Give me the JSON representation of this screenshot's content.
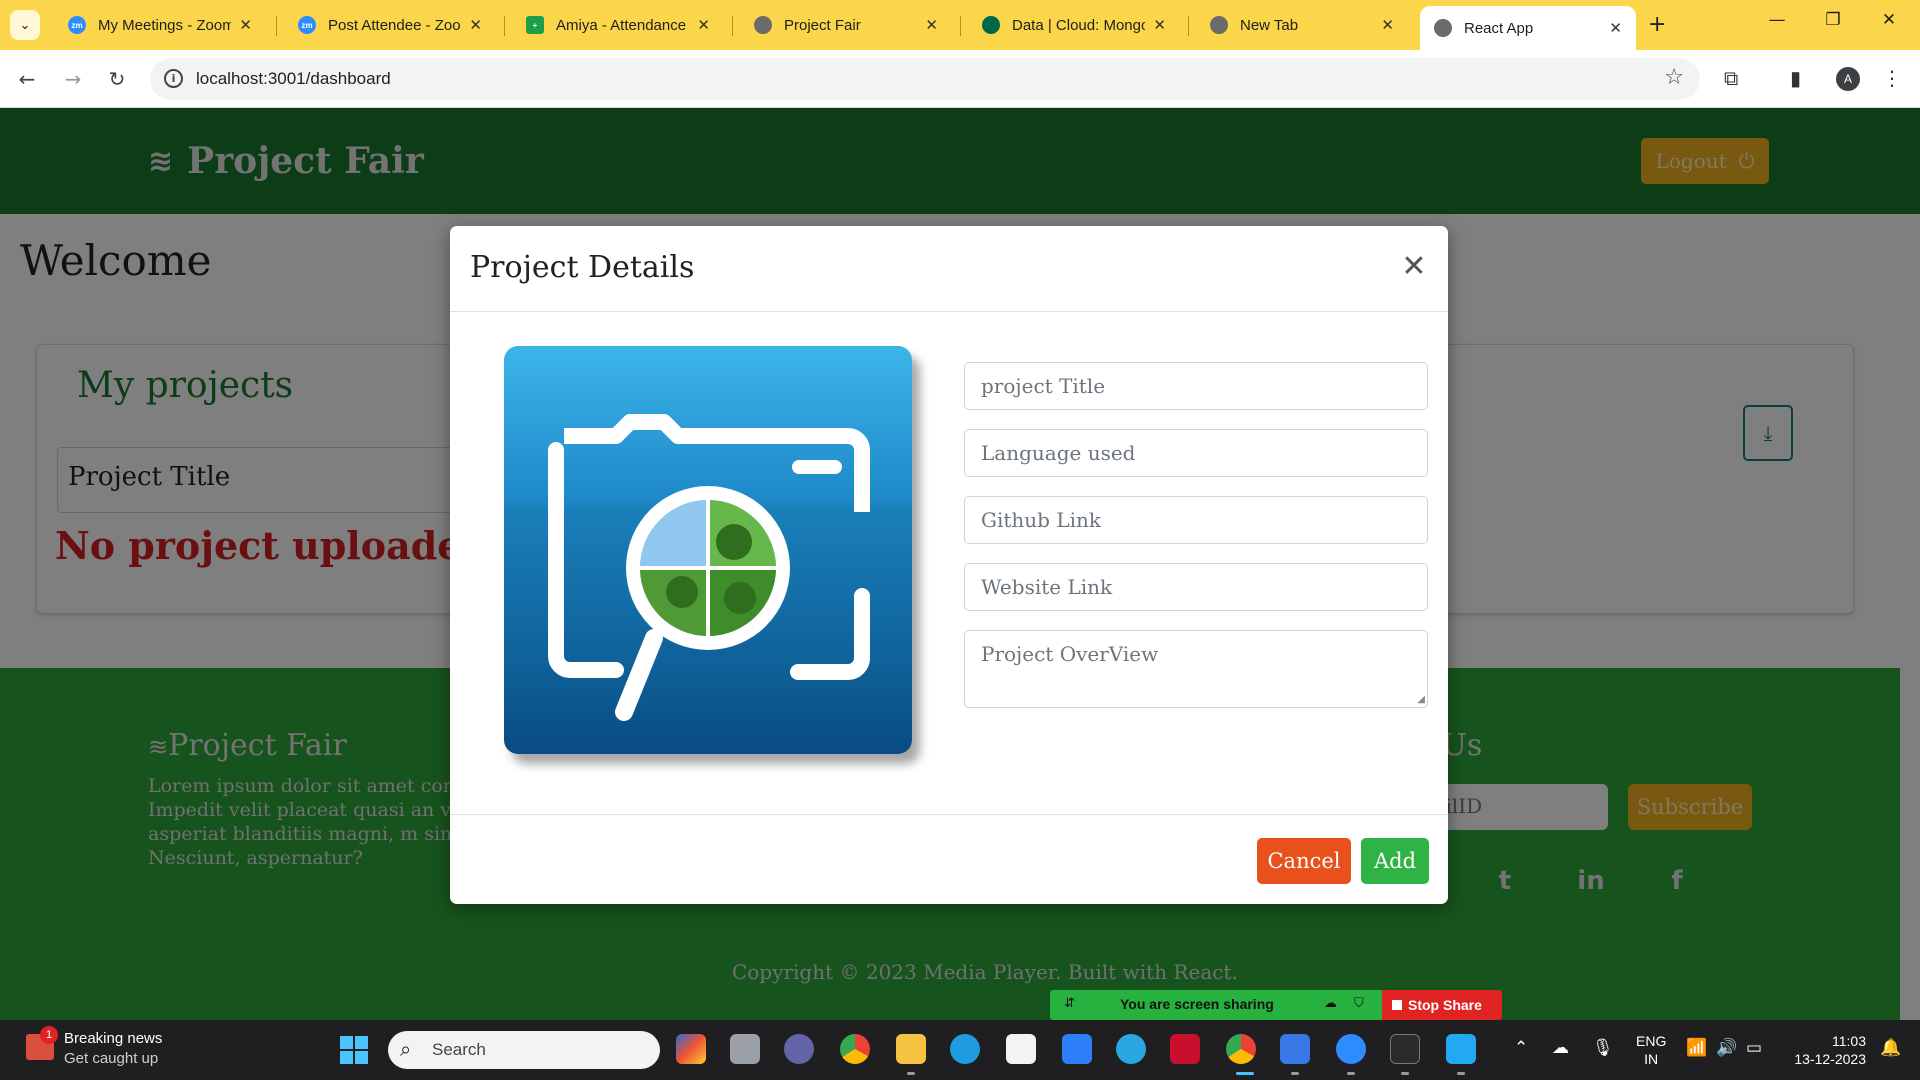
{
  "browser": {
    "tabs": [
      {
        "title": "My Meetings - Zoom",
        "favicon": "zoom-icon",
        "color": "#2d8cff"
      },
      {
        "title": "Post Attendee - Zoom",
        "favicon": "zoom-icon",
        "color": "#2d8cff"
      },
      {
        "title": "Amiya - Attendance",
        "favicon": "sheets-icon",
        "color": "#1e9e4a"
      },
      {
        "title": "Project Fair",
        "favicon": "globe-icon",
        "color": "#555555"
      },
      {
        "title": "Data | Cloud: MongoDB",
        "favicon": "mongodb-icon",
        "color": "#00684a"
      },
      {
        "title": "New Tab",
        "favicon": "chrome-icon",
        "color": "#555555"
      },
      {
        "title": "React App",
        "favicon": "globe-icon",
        "color": "#555555"
      }
    ],
    "url": "localhost:3001/dashboard",
    "profile_initial": "A"
  },
  "app": {
    "brand": "Project Fair",
    "logout_label": "Logout",
    "welcome": "Welcome",
    "my_projects_heading": "My projects",
    "project_title_label": "Project Title",
    "empty_message": "No project uploaded yet !!"
  },
  "footer": {
    "brand": "Project Fair",
    "text": "Lorem ipsum dolor sit amet conse elit. Impedit velit placeat quasi an vero asperiat blanditiis magni, m similique? Nesciunt, aspernatur?",
    "contact_heading": "t Us",
    "email_placeholder": "r EmailID",
    "subscribe_label": "Subscribe",
    "copyright": "Copyright © 2023 Media Player. Built with React."
  },
  "modal": {
    "title": "Project Details",
    "fields": {
      "title_placeholder": "project Title",
      "language_placeholder": "Language used",
      "github_placeholder": "Github Link",
      "website_placeholder": "Website Link",
      "overview_placeholder": "Project OverView"
    },
    "cancel_label": "Cancel",
    "add_label": "Add"
  },
  "screen_share": {
    "status": "You are screen sharing",
    "stop_label": "Stop Share"
  },
  "taskbar": {
    "news_title": "Breaking news",
    "news_subtitle": "Get caught up",
    "news_badge": "1",
    "search_label": "Search",
    "lang_line1": "ENG",
    "lang_line2": "IN",
    "time": "11:03",
    "date": "13-12-2023"
  },
  "colors": {
    "navbar": "#1b7a2e",
    "footer": "#2ea83a",
    "accent_yellow": "#f2b01e",
    "cancel": "#e8501c",
    "add": "#2fb344",
    "error_text": "#d42020"
  }
}
